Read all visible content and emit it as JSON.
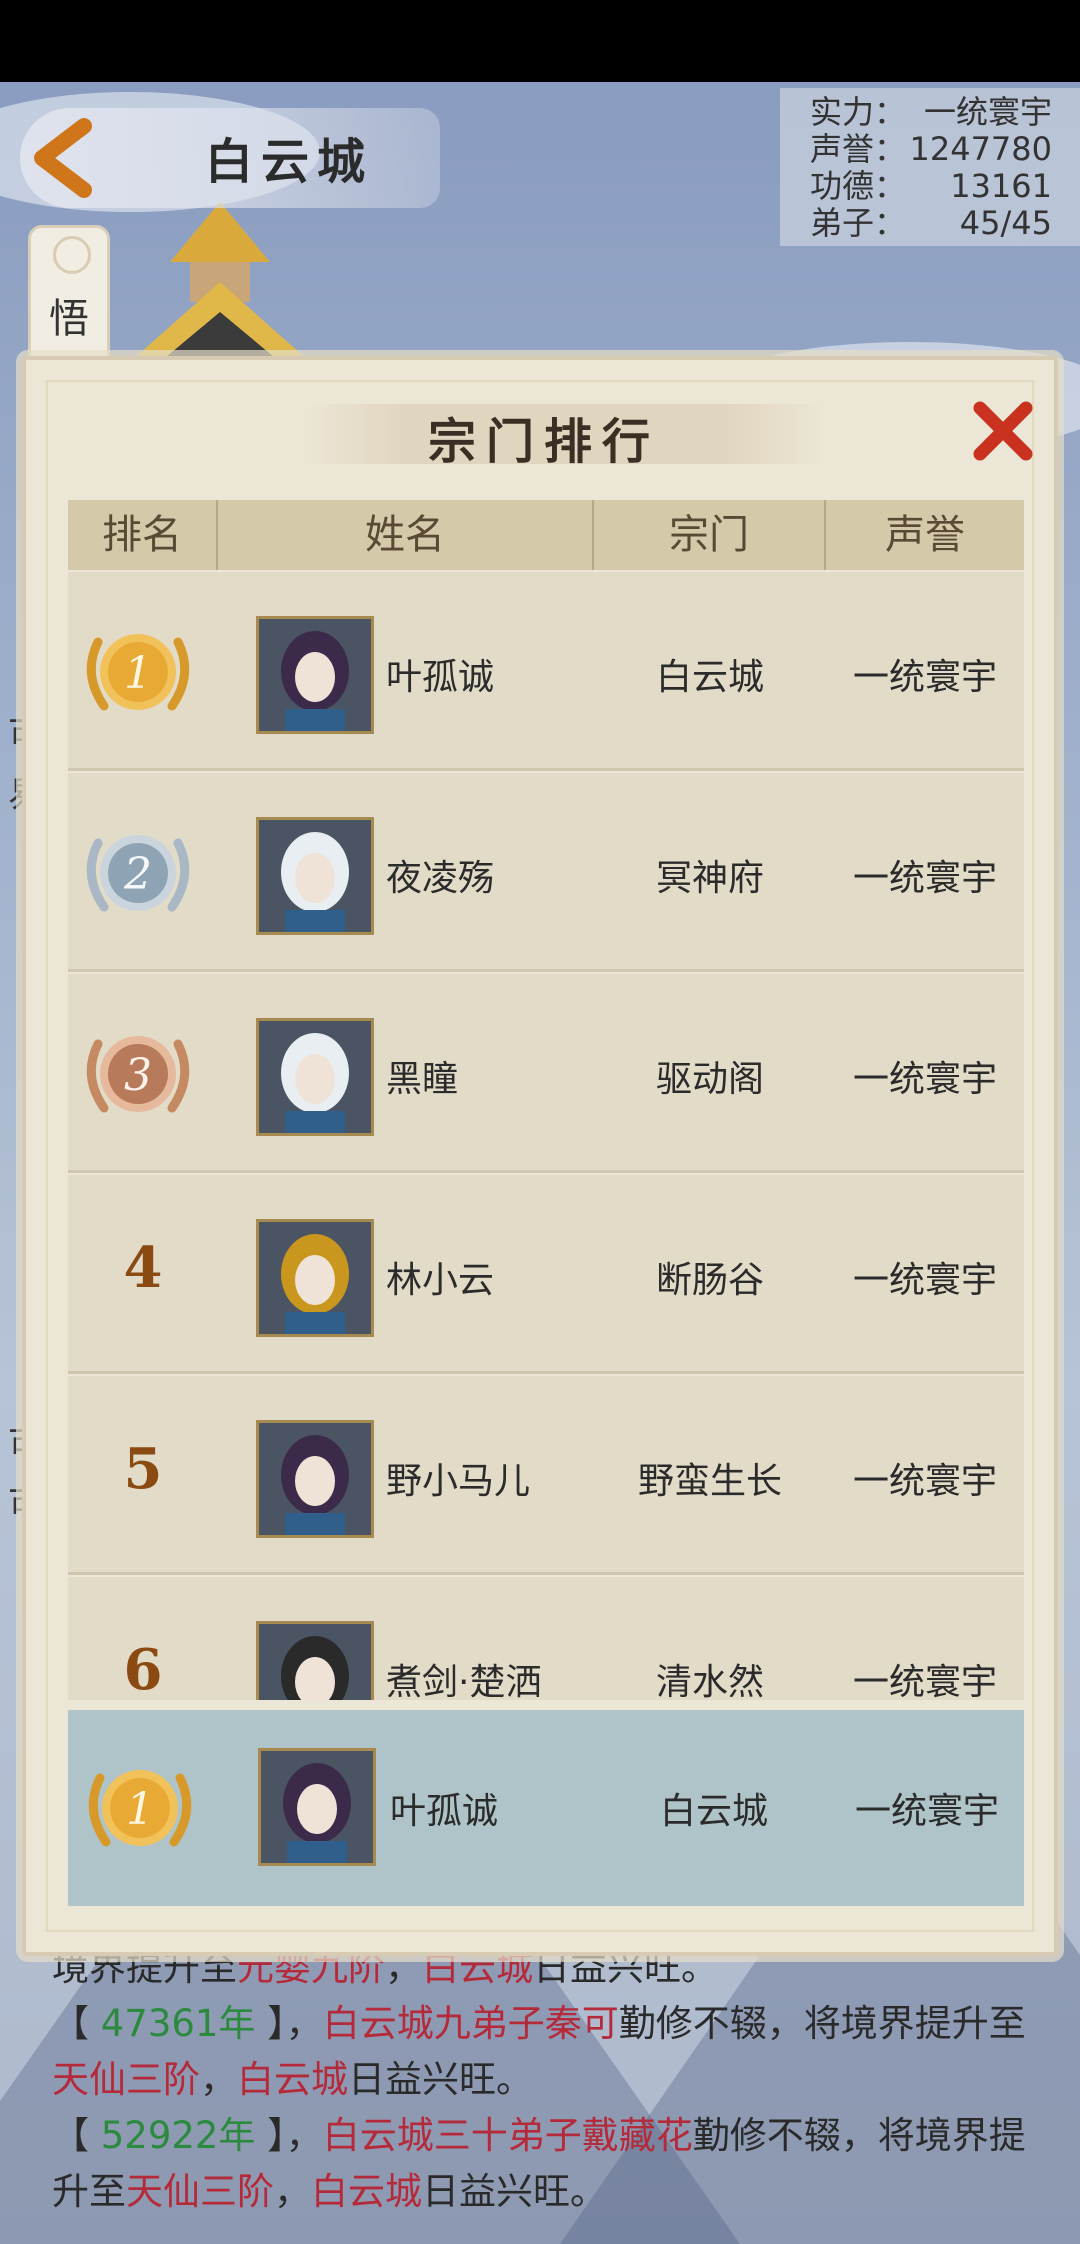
{
  "header": {
    "title": "白云城",
    "side_tab": "悟道"
  },
  "stats": [
    {
      "label": "实力：",
      "value": "一统寰宇"
    },
    {
      "label": "声誉：",
      "value": "1247780"
    },
    {
      "label": "功德：",
      "value": "13161"
    },
    {
      "label": "弟子：",
      "value": "45/45"
    }
  ],
  "edge_fragments": [
    "可",
    "易",
    "可",
    "可"
  ],
  "modal": {
    "title": "宗门排行",
    "columns": [
      "排名",
      "姓名",
      "宗门",
      "声誉"
    ]
  },
  "rankings": [
    {
      "rank": "1",
      "name": "叶孤诚",
      "sect": "白云城",
      "fame": "一统寰宇",
      "medal": "gold"
    },
    {
      "rank": "2",
      "name": "夜凌殇",
      "sect": "冥神府",
      "fame": "一统寰宇",
      "medal": "silver"
    },
    {
      "rank": "3",
      "name": "黑瞳",
      "sect": "驱动阁",
      "fame": "一统寰宇",
      "medal": "bronze"
    },
    {
      "rank": "4",
      "name": "林小云",
      "sect": "断肠谷",
      "fame": "一统寰宇",
      "medal": ""
    },
    {
      "rank": "5",
      "name": "野小马儿",
      "sect": "野蛮生长",
      "fame": "一统寰宇",
      "medal": ""
    },
    {
      "rank": "6",
      "name": "煮剑·楚洒",
      "sect": "清水然",
      "fame": "一统寰宇",
      "medal": ""
    }
  ],
  "my_rank": {
    "rank": "1",
    "name": "叶孤诚",
    "sect": "白云城",
    "fame": "一统寰宇",
    "medal": "gold"
  },
  "event_log": {
    "line1_pre": "境界提升至",
    "line1_realm": "元婴九阶",
    "line1_sep": "，",
    "line1_city": "白云城",
    "line1_post": "日益兴旺。",
    "entry2_open": "【 ",
    "entry2_year": "47361年",
    "entry2_close": " 】，",
    "entry2_subject": "白云城九弟子秦可",
    "entry2_mid": "勤修不辍，将境界提升至",
    "entry2_realm": "天仙三阶",
    "entry2_sep": "，",
    "entry2_city": "白云城",
    "entry2_post": "日益兴旺。",
    "entry3_open": "【 ",
    "entry3_year": "52922年",
    "entry3_close": " 】，",
    "entry3_subject": "白云城三十弟子戴藏花",
    "entry3_mid": "勤修不辍，将境界提升至",
    "entry3_realm": "天仙三阶",
    "entry3_sep": "，",
    "entry3_city": "白云城",
    "entry3_post": "日益兴旺。"
  },
  "colors": {
    "accent_red": "#b42a3a",
    "year_green": "#2b8a3e",
    "rank_brown": "#8a4a12",
    "header_tan": "#d4c9a8"
  }
}
